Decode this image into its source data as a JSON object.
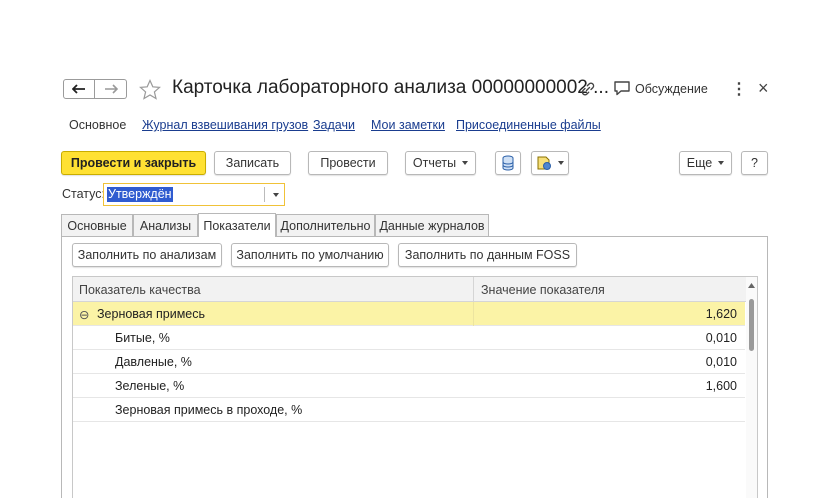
{
  "window": {
    "title": "Карточка лабораторного анализа 00000000002 ...",
    "discuss_label": "Обсуждение",
    "more_glyph": "⋮",
    "close_glyph": "×"
  },
  "nav_tabs": [
    {
      "label": "Основное",
      "active": true
    },
    {
      "label": "Журнал взвешивания грузов",
      "active": false
    },
    {
      "label": "Задачи",
      "active": false
    },
    {
      "label": "Мои заметки",
      "active": false
    },
    {
      "label": "Присоединенные файлы",
      "active": false
    }
  ],
  "toolbar": {
    "post_close": "Провести и закрыть",
    "save": "Записать",
    "post": "Провести",
    "reports": "Отчеты",
    "more": "Еще",
    "help": "?"
  },
  "status": {
    "label": "Статус:",
    "value": "Утверждён"
  },
  "form_tabs": [
    {
      "label": "Основные",
      "active": false
    },
    {
      "label": "Анализы",
      "active": false
    },
    {
      "label": "Показатели",
      "active": true
    },
    {
      "label": "Дополнительно",
      "active": false
    },
    {
      "label": "Данные журналов",
      "active": false
    }
  ],
  "fill_buttons": {
    "by_analyses": "Заполнить по анализам",
    "by_default": "Заполнить по умолчанию",
    "by_foss": "Заполнить по данным FOSS"
  },
  "table": {
    "columns": [
      "Показатель качества",
      "Значение показателя"
    ],
    "rows": [
      {
        "name": "Зерновая примесь",
        "value": "1,620",
        "group": true,
        "expanded_glyph": "⊖"
      },
      {
        "name": "Битые, %",
        "value": "0,010"
      },
      {
        "name": "Давленые, %",
        "value": "0,010"
      },
      {
        "name": "Зеленые, %",
        "value": "1,600"
      },
      {
        "name": "Зерновая примесь в проходе, %",
        "value": ""
      }
    ]
  },
  "colors": {
    "primary_button": "#ffe133",
    "selected_row": "#fbf3a6",
    "link": "#1a3d8f",
    "status_focus_border": "#f0c238",
    "status_selection": "#2f5bd0"
  }
}
